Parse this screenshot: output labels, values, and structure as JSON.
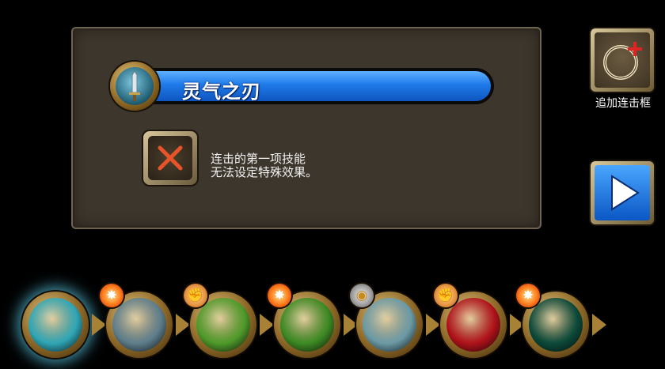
{
  "dialog": {
    "skill_name": "灵气之刃",
    "message_line1": "连击的第一项技能",
    "message_line2": "无法设定特殊效果。"
  },
  "sidebar": {
    "add_combo_label": "追加连击框"
  },
  "icons": {
    "skill_medallion": "sword-icon",
    "invalid": "x-icon",
    "add_combo": "add-ring-icon",
    "play": "play-icon"
  },
  "colors": {
    "name_bar": "#1e7ae8",
    "panel_bg": "#3d362c",
    "x_mark": "#e8532a",
    "play_button": "#0b56c4"
  },
  "skill_chain": [
    {
      "name": "sword-icon",
      "badge": "",
      "selected": true,
      "orb": "#2fa6b5"
    },
    {
      "name": "aura-figure-icon",
      "badge": "fire",
      "selected": false,
      "orb": "#5e7e8c"
    },
    {
      "name": "sword-slash-icon",
      "badge": "fist",
      "selected": false,
      "orb": "#4f9a2a"
    },
    {
      "name": "shield-icon",
      "badge": "fire",
      "selected": false,
      "orb": "#3d8a24"
    },
    {
      "name": "whirlwind-icon",
      "badge": "eye",
      "selected": false,
      "orb": "#6b9aa6"
    },
    {
      "name": "crimson-blade-icon",
      "badge": "fist",
      "selected": false,
      "orb": "#b0121a"
    },
    {
      "name": "green-wave-icon",
      "badge": "fire",
      "selected": false,
      "orb": "#0c4a3a"
    }
  ]
}
